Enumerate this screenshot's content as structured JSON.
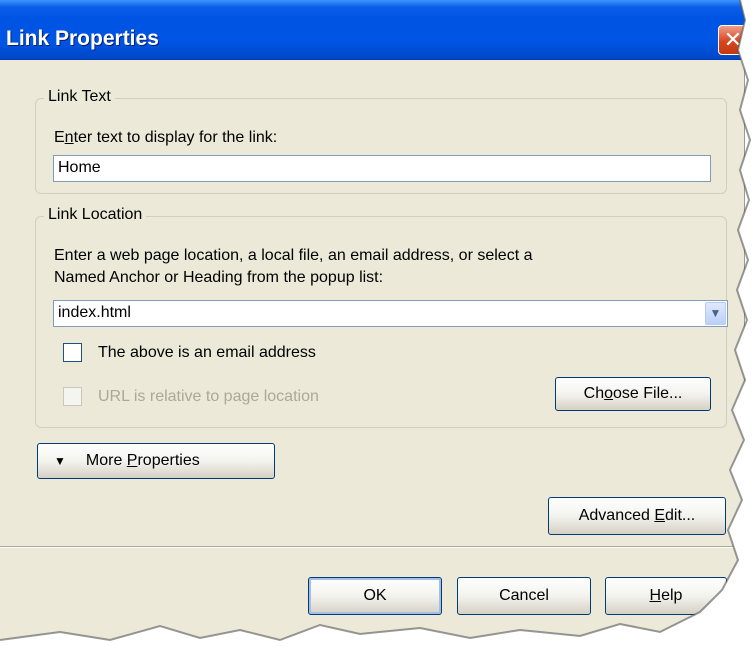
{
  "window": {
    "title": "Link Properties"
  },
  "link_text": {
    "group_label": "Link Text",
    "prompt_before": "E",
    "prompt_mn": "n",
    "prompt_after": "ter text to display for the link:",
    "value": "Home"
  },
  "link_location": {
    "group_label": "Link Location",
    "prompt_line1": "Enter a web page location, a local file, an email address, or select a",
    "prompt_line2": "Named Anchor or Heading from the popup list:",
    "value": "index.html",
    "email_checkbox_label": "The above is an email address",
    "email_checked": false,
    "relative_checkbox_label": "URL is relative to page location",
    "relative_checked": false,
    "choose_file_before": "Ch",
    "choose_file_mn": "o",
    "choose_file_after": "ose File..."
  },
  "more_properties": {
    "before": "More ",
    "mn": "P",
    "after": "roperties"
  },
  "advanced_edit": {
    "before": "Advanced ",
    "mn": "E",
    "after": "dit..."
  },
  "footer": {
    "ok_label": "OK",
    "cancel_label": "Cancel",
    "help_mn": "H",
    "help_after": "elp"
  },
  "colors": {
    "dialog_bg": "#ece9d8",
    "titlebar": "#0054e3",
    "close": "#d6461e"
  },
  "icons": [
    "close-icon",
    "dropdown-arrow-icon",
    "triangle-down-icon"
  ]
}
